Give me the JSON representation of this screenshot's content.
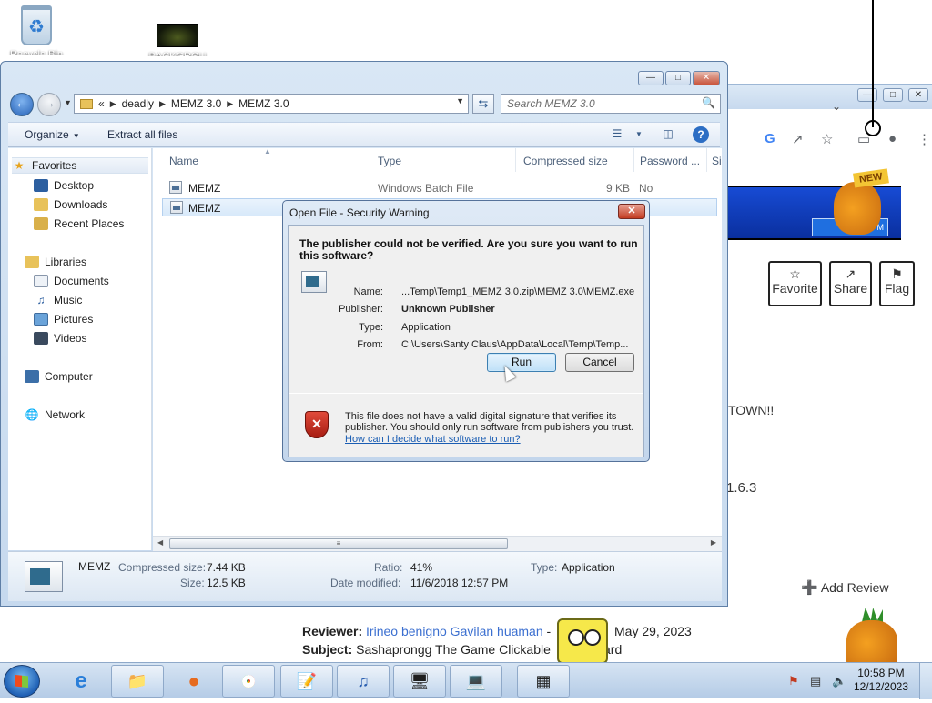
{
  "desktop": {
    "icons": [
      {
        "label": "Recycle Bin",
        "icon": "recycle-bin-icon"
      },
      {
        "label": "BACKGROU",
        "icon": "image-file-icon"
      }
    ]
  },
  "browser": {
    "badge": "NEW",
    "game_clock": "4 PM",
    "actions": [
      {
        "label": "Favorite",
        "icon": "star-icon"
      },
      {
        "label": "Share",
        "icon": "share-icon"
      },
      {
        "label": "Flag",
        "icon": "flag-icon"
      }
    ],
    "text_town": "TOWN!!",
    "version": "1.6.3",
    "add_review": "Add Review",
    "review": {
      "reviewer_label": "Reviewer:",
      "reviewer_name": "Irineo benigno Gavilan huaman",
      "reviewer_dash": "-",
      "date": "May 29, 2023",
      "subject_label": "Subject:",
      "subject_text_start": "Sashaprongg The Game Clickable",
      "subject_text_end": "zard"
    }
  },
  "explorer": {
    "breadcrumb": [
      "deadly",
      "MEMZ 3.0",
      "MEMZ 3.0"
    ],
    "breadcrumb_prefix": "«",
    "search_placeholder": "Search MEMZ 3.0",
    "toolbar": {
      "organize": "Organize",
      "extract": "Extract all files"
    },
    "nav": {
      "favorites": "Favorites",
      "favorites_items": [
        "Desktop",
        "Downloads",
        "Recent Places"
      ],
      "libraries": "Libraries",
      "libraries_items": [
        "Documents",
        "Music",
        "Pictures",
        "Videos"
      ],
      "computer": "Computer",
      "network": "Network"
    },
    "columns": [
      "Name",
      "Type",
      "Compressed size",
      "Password ...",
      "Si"
    ],
    "rows": [
      {
        "name": "MEMZ",
        "type": "Windows Batch File",
        "size": "9 KB",
        "password": "No"
      },
      {
        "name": "MEMZ",
        "type": "",
        "size": "",
        "password": ""
      }
    ],
    "details": {
      "name": "MEMZ",
      "compressed_label": "Compressed size:",
      "compressed_value": "7.44 KB",
      "size_label": "Size:",
      "size_value": "12.5 KB",
      "ratio_label": "Ratio:",
      "ratio_value": "41%",
      "modified_label": "Date modified:",
      "modified_value": "11/6/2018 12:57 PM",
      "type_label": "Type:",
      "type_value": "Application"
    }
  },
  "dialog": {
    "title": "Open File - Security Warning",
    "question": "The publisher could not be verified.  Are you sure you want to run this software?",
    "fields": [
      {
        "label": "Name:",
        "value": "...Temp\\Temp1_MEMZ 3.0.zip\\MEMZ 3.0\\MEMZ.exe",
        "bold": false
      },
      {
        "label": "Publisher:",
        "value": "Unknown Publisher",
        "bold": true
      },
      {
        "label": "Type:",
        "value": "Application",
        "bold": false
      },
      {
        "label": "From:",
        "value": "C:\\Users\\Santy Claus\\AppData\\Local\\Temp\\Temp...",
        "bold": false
      }
    ],
    "run": "Run",
    "cancel": "Cancel",
    "warning": "This file does not have a valid digital signature that verifies its publisher.  You should only run software from publishers you trust.",
    "link": "How can I decide what software to run?"
  },
  "taskbar": {
    "time": "10:58 PM",
    "date": "12/12/2023"
  },
  "colors": {
    "taskbar": "#b4cbe6",
    "explorer_frame": "#c6d9ee",
    "link": "#1a5db3",
    "shield_red": "#c23b21"
  }
}
